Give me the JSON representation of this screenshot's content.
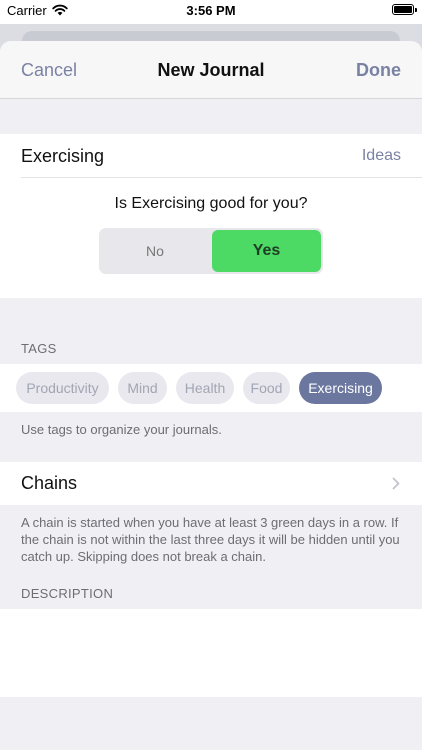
{
  "status_bar": {
    "carrier": "Carrier",
    "time": "3:56 PM"
  },
  "nav": {
    "cancel": "Cancel",
    "title": "New Journal",
    "done": "Done"
  },
  "journal": {
    "name": "Exercising",
    "ideas": "Ideas",
    "question": "Is Exercising good for you?",
    "toggle": {
      "no": "No",
      "yes": "Yes",
      "selected": "Yes"
    }
  },
  "tags": {
    "header": "TAGS",
    "items": [
      {
        "label": "Productivity",
        "selected": false
      },
      {
        "label": "Mind",
        "selected": false
      },
      {
        "label": "Health",
        "selected": false
      },
      {
        "label": "Food",
        "selected": false
      },
      {
        "label": "Exercising",
        "selected": true
      }
    ],
    "note": "Use tags to organize your journals."
  },
  "chains": {
    "label": "Chains",
    "note": "A chain is started when you have at least 3 green days in a row. If the chain is not within the last three days it will be hidden until you catch up. Skipping does not break a chain."
  },
  "description": {
    "header": "DESCRIPTION",
    "value": ""
  },
  "colors": {
    "accent": "#7a82a4",
    "toggle_yes": "#4cd964",
    "tag_selected": "#6b779f",
    "grouped_bg": "#efeff4"
  }
}
